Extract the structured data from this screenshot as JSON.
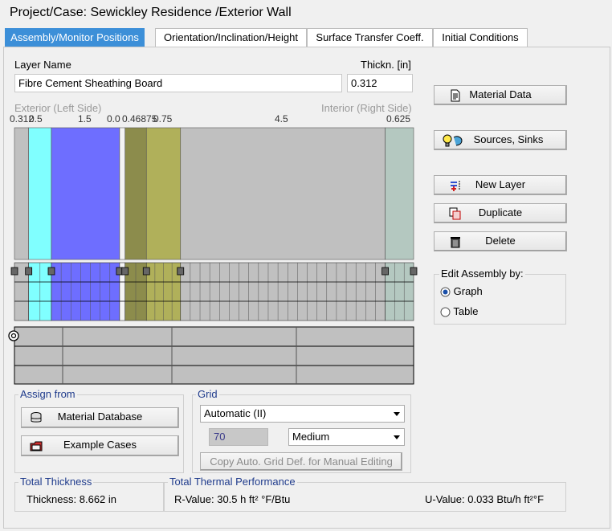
{
  "header": {
    "title": "Project/Case:  Sewickley Residence /Exterior Wall"
  },
  "tabs": [
    {
      "label": "Assembly/Monitor Positions",
      "active": true
    },
    {
      "label": "Orientation/Inclination/Height",
      "active": false
    },
    {
      "label": "Surface Transfer Coeff.",
      "active": false
    },
    {
      "label": "Initial Conditions",
      "active": false
    }
  ],
  "layer": {
    "name_label": "Layer Name",
    "name_value": "Fibre Cement Sheathing Board",
    "thick_label": "Thickn. [in]",
    "thick_value": "0.312"
  },
  "assembly": {
    "exterior_label": "Exterior (Left Side)",
    "interior_label": "Interior (Right Side)",
    "layers": [
      {
        "thickness": "0.312",
        "color": "#c0c0c0"
      },
      {
        "thickness": "0.5",
        "color": "#80ffff"
      },
      {
        "thickness": "1.5",
        "color": "#6e6eff"
      },
      {
        "thickness": "0.0",
        "color": "#f4f4f4"
      },
      {
        "thickness": "0.46875",
        "color": "#8c8c4c"
      },
      {
        "thickness": "0.75",
        "color": "#b0b05a"
      },
      {
        "thickness": "4.5",
        "color": "#c0c0c0"
      },
      {
        "thickness": "0.625",
        "color": "#b4c8c0"
      }
    ],
    "top_tick_labels": [
      "0.312",
      "0.5",
      "1.5",
      "0.0",
      "0.46875",
      "0.75",
      "4.5",
      "0.625"
    ]
  },
  "buttons": {
    "material_data": "Material Data",
    "sources_sinks": "Sources, Sinks",
    "new_layer": "New Layer",
    "duplicate": "Duplicate",
    "delete": "Delete"
  },
  "edit_assembly": {
    "title": "Edit Assembly by:",
    "options": [
      {
        "label": "Graph",
        "selected": true
      },
      {
        "label": "Table",
        "selected": false
      }
    ]
  },
  "assign_from": {
    "title": "Assign from",
    "material_database": "Material Database",
    "example_cases": "Example Cases"
  },
  "grid": {
    "title": "Grid",
    "mode": "Automatic (II)",
    "count": "70",
    "density": "Medium",
    "copy_button": "Copy Auto. Grid Def. for Manual Editing"
  },
  "total_thickness": {
    "title": "Total Thickness",
    "text": "Thickness: 8.662 in"
  },
  "thermal": {
    "title": "Total Thermal Performance",
    "r_value": "R-Value: 30.5 h ft² °F/Btu",
    "u_value": "U-Value: 0.033 Btu/h ft²°F"
  }
}
